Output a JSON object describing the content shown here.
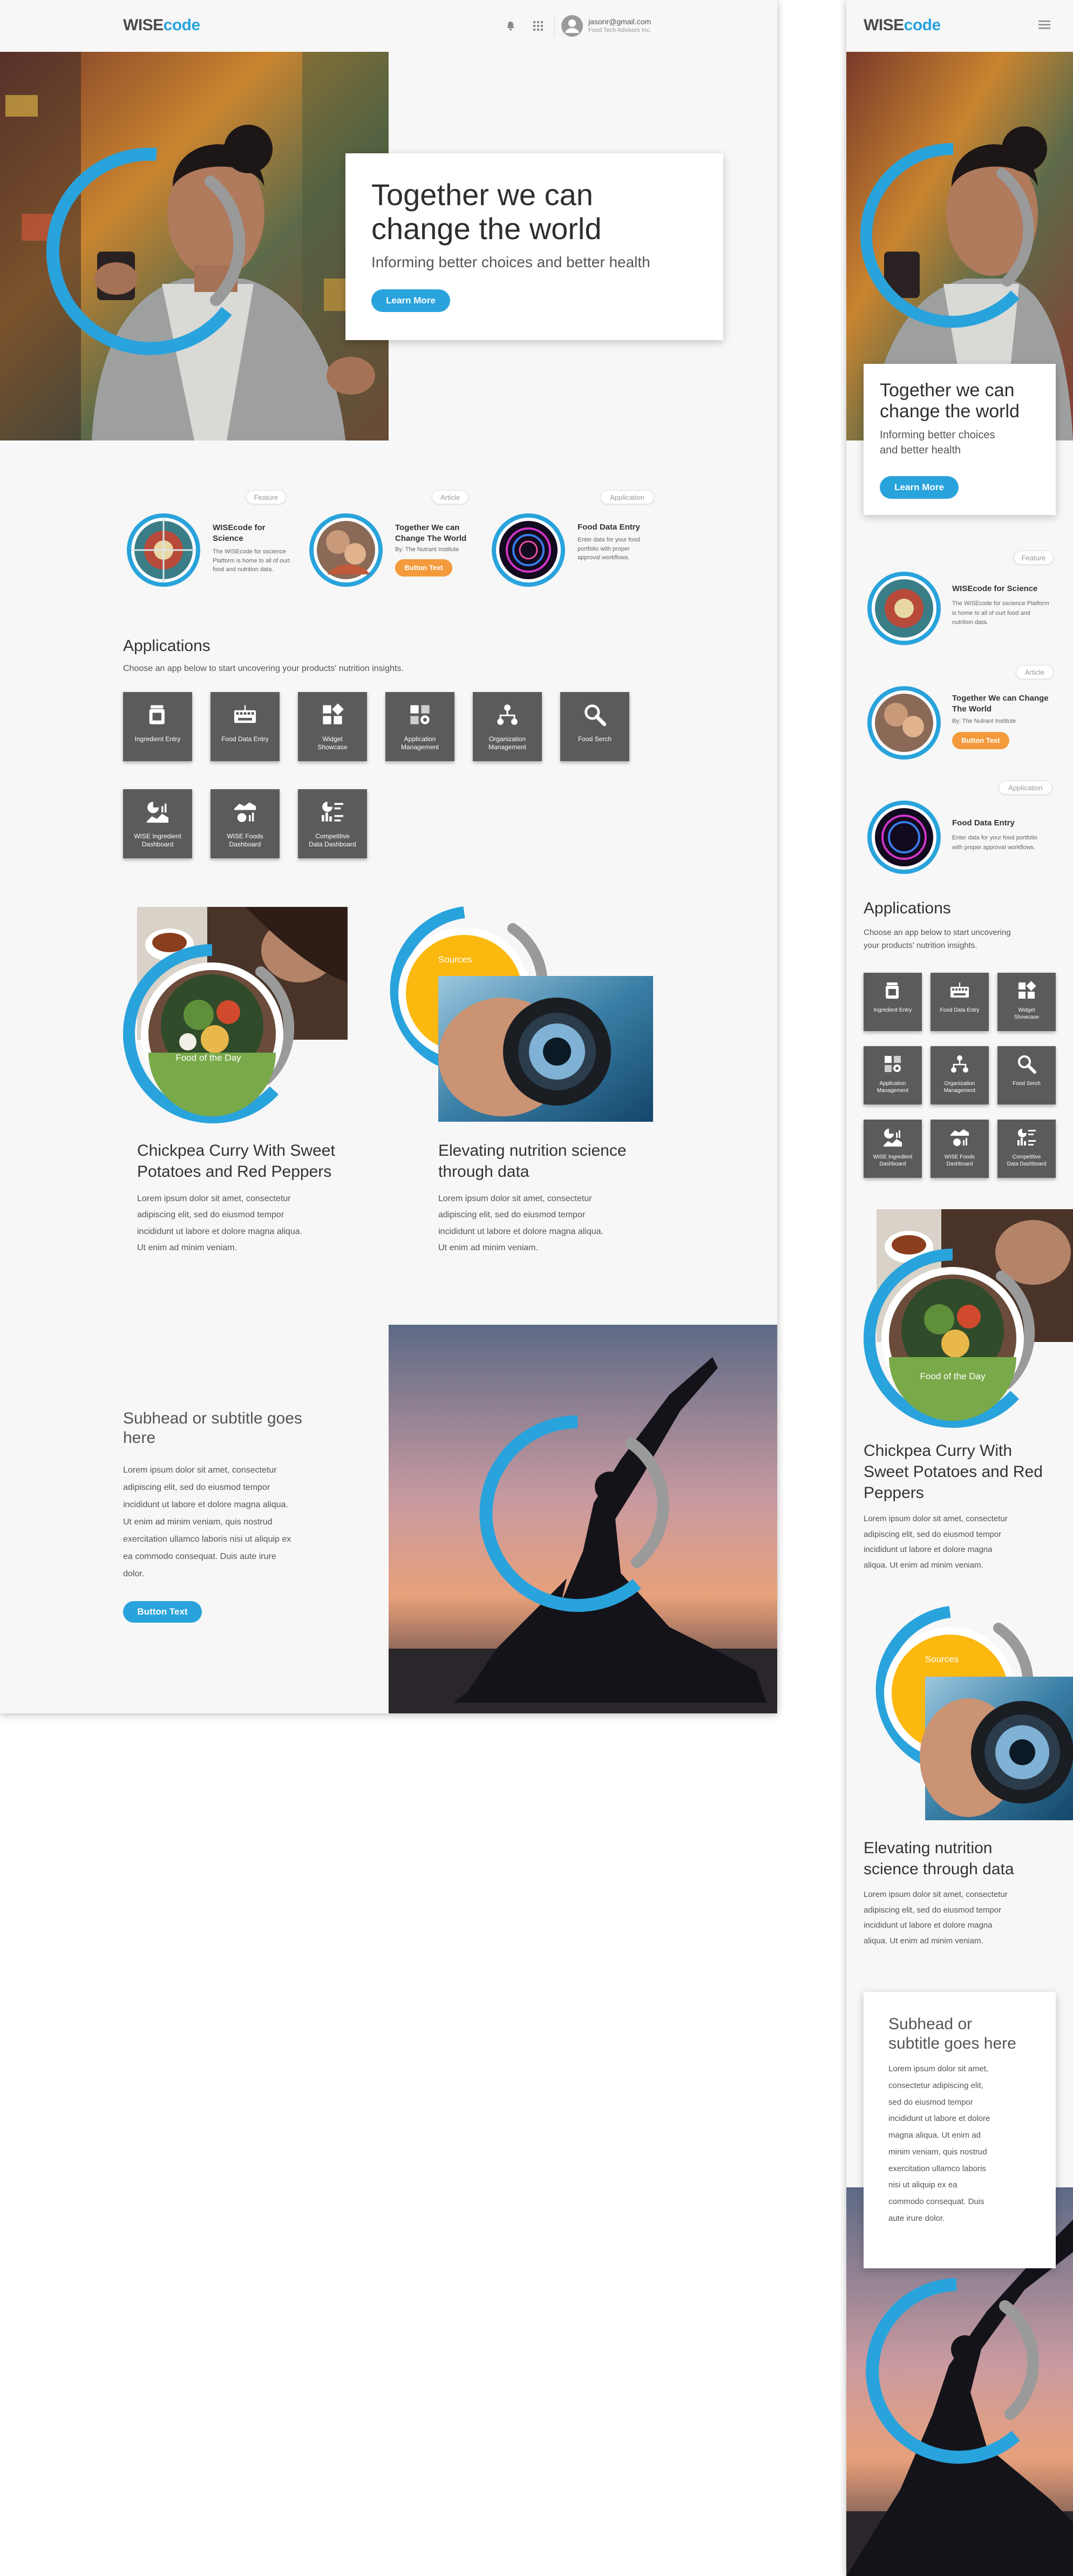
{
  "brand": {
    "logo_a": "WISE",
    "logo_b": "code",
    "accent": "#29a3dc",
    "orange": "#f39a3c"
  },
  "header": {
    "email": "jasonr@gmail.com",
    "org": "Food Tech Advisors Inc.",
    "icons": [
      "bell-icon",
      "apps-grid-icon",
      "user-avatar-icon",
      "hamburger-menu-icon"
    ]
  },
  "hero": {
    "title_line1": "Together we can",
    "title_line2": "change the world",
    "subtitle": "Informing better choices and better health",
    "button": "Learn More"
  },
  "features": [
    {
      "tag": "Feature",
      "title": "WISEcode for Science",
      "text": "The WISEcode for sscience Platform is home to all of ourt food and nutrition data."
    },
    {
      "tag": "Article",
      "title": "Together We can Change The World",
      "byline": "By: The Nutrant Institute",
      "button": "Button Text"
    },
    {
      "tag": "Application",
      "title": "Food Data Entry",
      "text": "Enter data for your food portfolio with proper approval workflows."
    }
  ],
  "applications": {
    "title": "Applications",
    "subtitle": "Choose an app below to start uncovering your products' nutrition insights.",
    "tiles": [
      {
        "label1": "Ingredient Entry",
        "label2": "",
        "icon": "jar-icon"
      },
      {
        "label1": "Food Data Entry",
        "label2": "",
        "icon": "keyboard-icon"
      },
      {
        "label1": "Widget",
        "label2": "Showcase",
        "icon": "widget-grid-icon"
      },
      {
        "label1": "Application",
        "label2": "Management",
        "icon": "app-management-icon"
      },
      {
        "label1": "Organization",
        "label2": "Management",
        "icon": "org-chart-icon"
      },
      {
        "label1": "Food Serch",
        "label2": "",
        "icon": "magnifier-icon"
      },
      {
        "label1": "WISE Ingredient",
        "label2": "Dashboard",
        "icon": "ingredient-dashboard-icon"
      },
      {
        "label1": "WISE Foods",
        "label2": "Dashboard",
        "icon": "foods-dashboard-icon"
      },
      {
        "label1": "Competitive",
        "label2": "Data Dashboard",
        "icon": "competitive-dashboard-icon"
      }
    ]
  },
  "stories": [
    {
      "badge": "Food of the Day",
      "title_line1": "Chickpea Curry With Sweet",
      "title_line2": "Potatoes and Red Peppers",
      "text_lines": [
        "Lorem ipsum dolor sit amet, consectetur",
        "adipiscing elit, sed do eiusmod tempor",
        "incididunt ut labore et dolore magna aliqua.",
        "Ut enim ad minim veniam."
      ]
    },
    {
      "badge": "Sources",
      "title_line1": "Elevating nutrition science",
      "title_line2": "through data",
      "text_lines": [
        "Lorem ipsum dolor sit amet, consectetur",
        "adipiscing elit, sed do eiusmod tempor",
        "incididunt ut labore et dolore magna aliqua.",
        "Ut enim ad minim veniam."
      ]
    }
  ],
  "promo": {
    "title_line1": "Subhead or subtitle goes",
    "title_line2": "here",
    "text_lines": [
      "Lorem ipsum dolor sit amet, consectetur",
      "adipiscing elit, sed do eiusmod tempor",
      "incididunt ut labore et dolore magna aliqua.",
      "Ut enim ad minim veniam, quis nostrud",
      "exercitation ullamco laboris nisi ut aliquip ex",
      "ea commodo consequat. Duis aute irure",
      "dolor."
    ],
    "button": "Button Text"
  },
  "mobile": {
    "hero_title_line1": "Together we can",
    "hero_title_line2": "change the world",
    "hero_sub_line1": "Informing better choices",
    "hero_sub_line2": "and better health",
    "feature1_title": "WISEcode for Science",
    "feature1_lines": [
      "The WISEcode for sscience Platform",
      "is home to all of ourt food and",
      "nutrition data."
    ],
    "feature2_title_line1": "Together We can Change",
    "feature2_title_line2": "The World",
    "feature3_lines": [
      "Enter data for your food portfolio",
      "with proper approval workflows."
    ],
    "apps_sub_line1": "Choose an app below to start uncovering",
    "apps_sub_line2": "your products' nutrition insights.",
    "story1_title": [
      "Chickpea Curry With",
      "Sweet Potatoes and Red",
      "Peppers"
    ],
    "story_text": [
      "Lorem ipsum dolor sit amet, consectetur",
      "adipiscing elit, sed do eiusmod tempor",
      "incididunt ut labore et dolore magna",
      "aliqua. Ut enim ad minim veniam."
    ],
    "story2_title": [
      "Elevating nutrition",
      "science through data"
    ],
    "promo_title": [
      "Subhead or",
      "subtitle goes here"
    ],
    "promo_lines": [
      "Lorem ipsum dolor sit amet,",
      "consectetur adipiscing elit,",
      "sed do eiusmod tempor",
      "incididunt ut labore et dolore",
      "magna aliqua. Ut enim ad",
      "minim veniam, quis nostrud",
      "exercitation ullamco laboris",
      "nisi ut aliquip ex ea",
      "commodo consequat. Duis",
      "aute irure dolor."
    ]
  }
}
